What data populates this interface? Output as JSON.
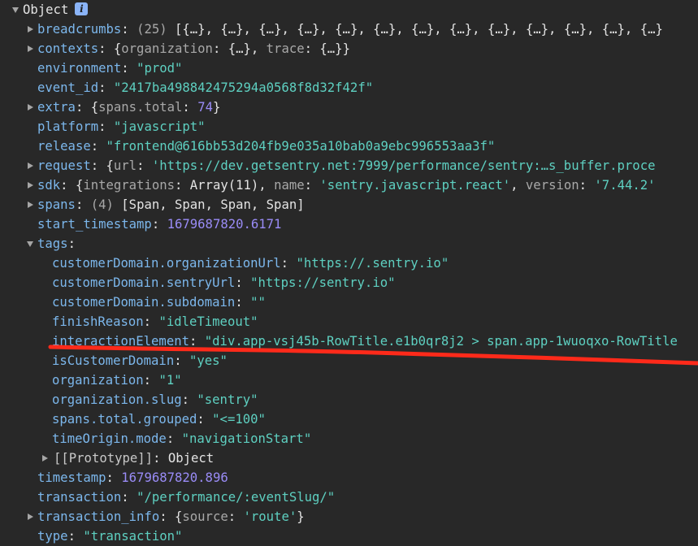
{
  "root": {
    "label": "Object",
    "info_icon": "i"
  },
  "rows": [
    {
      "id": "breadcrumbs",
      "indent": 1,
      "arrow": "right",
      "key": "breadcrumbs",
      "sep": ": ",
      "parts": [
        {
          "t": "(25) ",
          "c": "dim"
        },
        {
          "t": "[{…}, {…}, {…}, {…}, {…}, {…}, {…}, {…}, {…}, {…}, {…}, {…}, {…}",
          "c": "val-plain"
        }
      ]
    },
    {
      "id": "contexts",
      "indent": 1,
      "arrow": "right",
      "key": "contexts",
      "sep": ": ",
      "parts": [
        {
          "t": "{",
          "c": "val-plain"
        },
        {
          "t": "organization",
          "c": "dim"
        },
        {
          "t": ": {…}, ",
          "c": "val-plain"
        },
        {
          "t": "trace",
          "c": "dim"
        },
        {
          "t": ": {…}}",
          "c": "val-plain"
        }
      ]
    },
    {
      "id": "environment",
      "indent": 1,
      "arrow": "none",
      "key": "environment",
      "sep": ": ",
      "parts": [
        {
          "t": "\"prod\"",
          "c": "val-str"
        }
      ]
    },
    {
      "id": "event_id",
      "indent": 1,
      "arrow": "none",
      "key": "event_id",
      "sep": ": ",
      "parts": [
        {
          "t": "\"2417ba498842475294a0568f8d32f42f\"",
          "c": "val-str"
        }
      ]
    },
    {
      "id": "extra",
      "indent": 1,
      "arrow": "right",
      "key": "extra",
      "sep": ": ",
      "parts": [
        {
          "t": "{",
          "c": "val-plain"
        },
        {
          "t": "spans.total",
          "c": "dim"
        },
        {
          "t": ": ",
          "c": "val-plain"
        },
        {
          "t": "74",
          "c": "val-num"
        },
        {
          "t": "}",
          "c": "val-plain"
        }
      ]
    },
    {
      "id": "platform",
      "indent": 1,
      "arrow": "none",
      "key": "platform",
      "sep": ": ",
      "parts": [
        {
          "t": "\"javascript\"",
          "c": "val-str"
        }
      ]
    },
    {
      "id": "release",
      "indent": 1,
      "arrow": "none",
      "key": "release",
      "sep": ": ",
      "parts": [
        {
          "t": "\"frontend@616bb53d204fb9e035a10bab0a9ebc996553aa3f\"",
          "c": "val-str"
        }
      ]
    },
    {
      "id": "request",
      "indent": 1,
      "arrow": "right",
      "key": "request",
      "sep": ": ",
      "parts": [
        {
          "t": "{",
          "c": "val-plain"
        },
        {
          "t": "url",
          "c": "dim"
        },
        {
          "t": ": ",
          "c": "val-plain"
        },
        {
          "t": "'https://dev.getsentry.net:7999/performance/sentry:…s_buffer.proce",
          "c": "val-str"
        }
      ]
    },
    {
      "id": "sdk",
      "indent": 1,
      "arrow": "right",
      "key": "sdk",
      "sep": ": ",
      "parts": [
        {
          "t": "{",
          "c": "val-plain"
        },
        {
          "t": "integrations",
          "c": "dim"
        },
        {
          "t": ": Array(11), ",
          "c": "val-plain"
        },
        {
          "t": "name",
          "c": "dim"
        },
        {
          "t": ": ",
          "c": "val-plain"
        },
        {
          "t": "'sentry.javascript.react'",
          "c": "val-str"
        },
        {
          "t": ", ",
          "c": "val-plain"
        },
        {
          "t": "version",
          "c": "dim"
        },
        {
          "t": ": ",
          "c": "val-plain"
        },
        {
          "t": "'7.44.2'",
          "c": "val-str"
        }
      ]
    },
    {
      "id": "spans",
      "indent": 1,
      "arrow": "right",
      "key": "spans",
      "sep": ": ",
      "parts": [
        {
          "t": "(4) ",
          "c": "dim"
        },
        {
          "t": "[Span, Span, Span, Span]",
          "c": "val-plain"
        }
      ]
    },
    {
      "id": "start_timestamp",
      "indent": 1,
      "arrow": "none",
      "key": "start_timestamp",
      "sep": ": ",
      "parts": [
        {
          "t": "1679687820.6171",
          "c": "val-num"
        }
      ]
    },
    {
      "id": "tags",
      "indent": 1,
      "arrow": "down",
      "key": "tags",
      "sep": ":",
      "parts": []
    },
    {
      "id": "customerDomain.organizationUrl",
      "indent": 2,
      "arrow": "none",
      "key": "customerDomain.organizationUrl",
      "sep": ": ",
      "parts": [
        {
          "t": "\"https://.sentry.io\"",
          "c": "val-str"
        }
      ]
    },
    {
      "id": "customerDomain.sentryUrl",
      "indent": 2,
      "arrow": "none",
      "key": "customerDomain.sentryUrl",
      "sep": ": ",
      "parts": [
        {
          "t": "\"https://sentry.io\"",
          "c": "val-str"
        }
      ]
    },
    {
      "id": "customerDomain.subdomain",
      "indent": 2,
      "arrow": "none",
      "key": "customerDomain.subdomain",
      "sep": ": ",
      "parts": [
        {
          "t": "\"\"",
          "c": "val-str"
        }
      ]
    },
    {
      "id": "finishReason",
      "indent": 2,
      "arrow": "none",
      "key": "finishReason",
      "sep": ": ",
      "parts": [
        {
          "t": "\"idleTimeout\"",
          "c": "val-str"
        }
      ]
    },
    {
      "id": "interactionElement",
      "indent": 2,
      "arrow": "none",
      "key": "interactionElement",
      "sep": ": ",
      "parts": [
        {
          "t": "\"div.app-vsj45b-RowTitle.e1b0qr8j2 > span.app-1wuoqxo-RowTitle",
          "c": "val-str"
        }
      ]
    },
    {
      "id": "isCustomerDomain",
      "indent": 2,
      "arrow": "none",
      "key": "isCustomerDomain",
      "sep": ": ",
      "parts": [
        {
          "t": "\"yes\"",
          "c": "val-str"
        }
      ]
    },
    {
      "id": "organization",
      "indent": 2,
      "arrow": "none",
      "key": "organization",
      "sep": ": ",
      "parts": [
        {
          "t": "\"1\"",
          "c": "val-str"
        }
      ]
    },
    {
      "id": "organization.slug",
      "indent": 2,
      "arrow": "none",
      "key": "organization.slug",
      "sep": ": ",
      "parts": [
        {
          "t": "\"sentry\"",
          "c": "val-str"
        }
      ]
    },
    {
      "id": "spans.total.grouped",
      "indent": 2,
      "arrow": "none",
      "key": "spans.total.grouped",
      "sep": ": ",
      "parts": [
        {
          "t": "\"<=100\"",
          "c": "val-str"
        }
      ]
    },
    {
      "id": "timeOrigin.mode",
      "indent": 2,
      "arrow": "none",
      "key": "timeOrigin.mode",
      "sep": ": ",
      "parts": [
        {
          "t": "\"navigationStart\"",
          "c": "val-str"
        }
      ]
    },
    {
      "id": "prototype",
      "indent": 2,
      "arrow": "right",
      "key": "[[Prototype]]",
      "keyClass": "proto-key",
      "sep": ": ",
      "parts": [
        {
          "t": "Object",
          "c": "val-plain"
        }
      ]
    },
    {
      "id": "timestamp",
      "indent": 1,
      "arrow": "none",
      "key": "timestamp",
      "sep": ": ",
      "parts": [
        {
          "t": "1679687820.896",
          "c": "val-num"
        }
      ]
    },
    {
      "id": "transaction",
      "indent": 1,
      "arrow": "none",
      "key": "transaction",
      "sep": ": ",
      "parts": [
        {
          "t": "\"/performance/:eventSlug/\"",
          "c": "val-str"
        }
      ]
    },
    {
      "id": "transaction_info",
      "indent": 1,
      "arrow": "right",
      "key": "transaction_info",
      "sep": ": ",
      "parts": [
        {
          "t": "{",
          "c": "val-plain"
        },
        {
          "t": "source",
          "c": "dim"
        },
        {
          "t": ": ",
          "c": "val-plain"
        },
        {
          "t": "'route'",
          "c": "val-str"
        },
        {
          "t": "}",
          "c": "val-plain"
        }
      ]
    },
    {
      "id": "type",
      "indent": 1,
      "arrow": "none",
      "key": "type",
      "sep": ": ",
      "parts": [
        {
          "t": "\"transaction\"",
          "c": "val-str"
        }
      ]
    }
  ],
  "colors": {
    "background": "#282828",
    "key": "#7cb7ec",
    "string": "#5ed0c1",
    "number": "#9a8cf7",
    "annotation": "#ff2a1a"
  },
  "annotation": {
    "type": "freehand-underline",
    "target_row": "interactionElement"
  }
}
